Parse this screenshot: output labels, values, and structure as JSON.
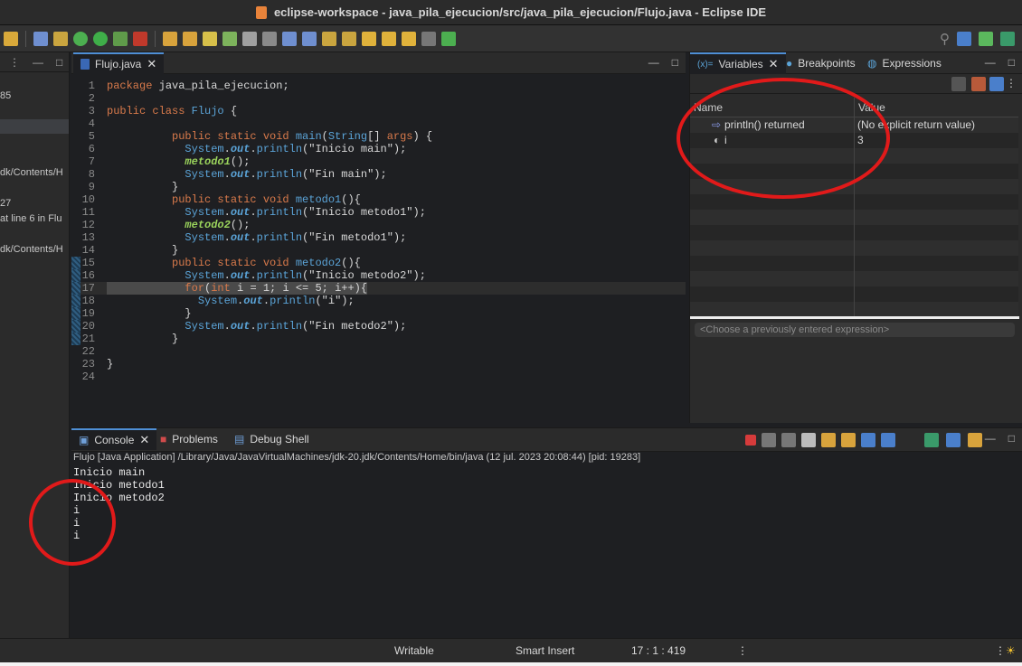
{
  "window": {
    "title": "eclipse-workspace - java_pila_ejecucion/src/java_pila_ejecucion/Flujo.java - Eclipse IDE"
  },
  "left_panel": {
    "lines": [
      "85",
      "dk/Contents/H",
      "27",
      "at line 6 in Flu",
      "dk/Contents/H"
    ]
  },
  "editor": {
    "tab_label": "Flujo.java",
    "close_glyph": "✕",
    "lines": [
      {
        "n": "1",
        "parts": [
          [
            "kw",
            "package"
          ],
          [
            "",
            " java_pila_ejecucion;"
          ]
        ]
      },
      {
        "n": "2",
        "parts": []
      },
      {
        "n": "3",
        "parts": [
          [
            "kw",
            "public class"
          ],
          [
            "",
            " "
          ],
          [
            "cls",
            "Flujo"
          ],
          [
            "",
            " {"
          ]
        ]
      },
      {
        "n": "4",
        "parts": []
      },
      {
        "n": "5",
        "parts": [
          [
            "",
            "          "
          ],
          [
            "kw",
            "public static void"
          ],
          [
            "",
            " "
          ],
          [
            "fn",
            "main"
          ],
          [
            "",
            "("
          ],
          [
            "cls",
            "String"
          ],
          [
            "",
            "[] "
          ],
          [
            "kw",
            "args"
          ],
          [
            "",
            ") {"
          ]
        ]
      },
      {
        "n": "6",
        "parts": [
          [
            "",
            "            "
          ],
          [
            "cls",
            "System"
          ],
          [
            "",
            "."
          ],
          [
            "field",
            "out"
          ],
          [
            "",
            "."
          ],
          [
            "fn",
            "println"
          ],
          [
            "",
            "(\"Inicio main\");"
          ]
        ]
      },
      {
        "n": "7",
        "parts": [
          [
            "",
            "            "
          ],
          [
            "it",
            "metodo1"
          ],
          [
            "",
            "();"
          ]
        ]
      },
      {
        "n": "8",
        "parts": [
          [
            "",
            "            "
          ],
          [
            "cls",
            "System"
          ],
          [
            "",
            "."
          ],
          [
            "field",
            "out"
          ],
          [
            "",
            "."
          ],
          [
            "fn",
            "println"
          ],
          [
            "",
            "(\"Fin main\");"
          ]
        ]
      },
      {
        "n": "9",
        "parts": [
          [
            "",
            "          }"
          ]
        ]
      },
      {
        "n": "10",
        "parts": [
          [
            "",
            "          "
          ],
          [
            "kw",
            "public static void"
          ],
          [
            "",
            " "
          ],
          [
            "fn",
            "metodo1"
          ],
          [
            "",
            "(){"
          ]
        ]
      },
      {
        "n": "11",
        "parts": [
          [
            "",
            "            "
          ],
          [
            "cls",
            "System"
          ],
          [
            "",
            "."
          ],
          [
            "field",
            "out"
          ],
          [
            "",
            "."
          ],
          [
            "fn",
            "println"
          ],
          [
            "",
            "(\"Inicio metodo1\");"
          ]
        ]
      },
      {
        "n": "12",
        "parts": [
          [
            "",
            "            "
          ],
          [
            "it",
            "metodo2"
          ],
          [
            "",
            "();"
          ]
        ]
      },
      {
        "n": "13",
        "parts": [
          [
            "",
            "            "
          ],
          [
            "cls",
            "System"
          ],
          [
            "",
            "."
          ],
          [
            "field",
            "out"
          ],
          [
            "",
            "."
          ],
          [
            "fn",
            "println"
          ],
          [
            "",
            "(\"Fin metodo1\");"
          ]
        ]
      },
      {
        "n": "14",
        "parts": [
          [
            "",
            "          }"
          ]
        ]
      },
      {
        "n": "15",
        "parts": [
          [
            "",
            "          "
          ],
          [
            "kw",
            "public static void"
          ],
          [
            "",
            " "
          ],
          [
            "fn",
            "metodo2"
          ],
          [
            "",
            "(){"
          ]
        ]
      },
      {
        "n": "16",
        "parts": [
          [
            "",
            "            "
          ],
          [
            "cls",
            "System"
          ],
          [
            "",
            "."
          ],
          [
            "field",
            "out"
          ],
          [
            "",
            "."
          ],
          [
            "fn",
            "println"
          ],
          [
            "",
            "(\"Inicio metodo2\");"
          ]
        ]
      },
      {
        "n": "17",
        "parts": [
          [
            "",
            "            "
          ],
          [
            "kw",
            "for"
          ],
          [
            "",
            "("
          ],
          [
            "kw",
            "int"
          ],
          [
            "",
            " i = 1; i <= 5; i++){"
          ]
        ]
      },
      {
        "n": "18",
        "parts": [
          [
            "",
            "              "
          ],
          [
            "cls",
            "System"
          ],
          [
            "",
            "."
          ],
          [
            "field",
            "out"
          ],
          [
            "",
            "."
          ],
          [
            "fn",
            "println"
          ],
          [
            "",
            "(\"i\");"
          ]
        ]
      },
      {
        "n": "19",
        "parts": [
          [
            "",
            "            }"
          ]
        ]
      },
      {
        "n": "20",
        "parts": [
          [
            "",
            "            "
          ],
          [
            "cls",
            "System"
          ],
          [
            "",
            "."
          ],
          [
            "field",
            "out"
          ],
          [
            "",
            "."
          ],
          [
            "fn",
            "println"
          ],
          [
            "",
            "(\"Fin metodo2\");"
          ]
        ]
      },
      {
        "n": "21",
        "parts": [
          [
            "",
            "          }"
          ]
        ]
      },
      {
        "n": "22",
        "parts": []
      },
      {
        "n": "23",
        "parts": [
          [
            "",
            "}"
          ]
        ]
      },
      {
        "n": "24",
        "parts": []
      }
    ],
    "current_line": "17"
  },
  "variables_view": {
    "tabs": [
      "Variables",
      "Breakpoints",
      "Expressions"
    ],
    "tab_prefix": "(x)=",
    "columns": [
      "Name",
      "Value"
    ],
    "rows": [
      {
        "name": "println() returned",
        "value": "(No explicit return value)"
      },
      {
        "name": "i",
        "value": "3"
      }
    ],
    "expression_placeholder": "<Choose a previously entered expression>"
  },
  "console": {
    "tabs": [
      "Console",
      "Problems",
      "Debug Shell"
    ],
    "info": "Flujo [Java Application] /Library/Java/JavaVirtualMachines/jdk-20.jdk/Contents/Home/bin/java  (12 jul. 2023 20:08:44) [pid: 19283]",
    "output": [
      "Inicio main",
      "Inicio metodo1",
      "Inicio metodo2",
      "i",
      "i",
      "i"
    ]
  },
  "status_bar": {
    "writable": "Writable",
    "insert_mode": "Smart Insert",
    "position": "17 : 1 : 419"
  },
  "colors": {
    "annotation": "#e11a1a",
    "keyword": "#d97a4b",
    "type": "#5ba4d8",
    "method_call": "#9bd45c"
  }
}
